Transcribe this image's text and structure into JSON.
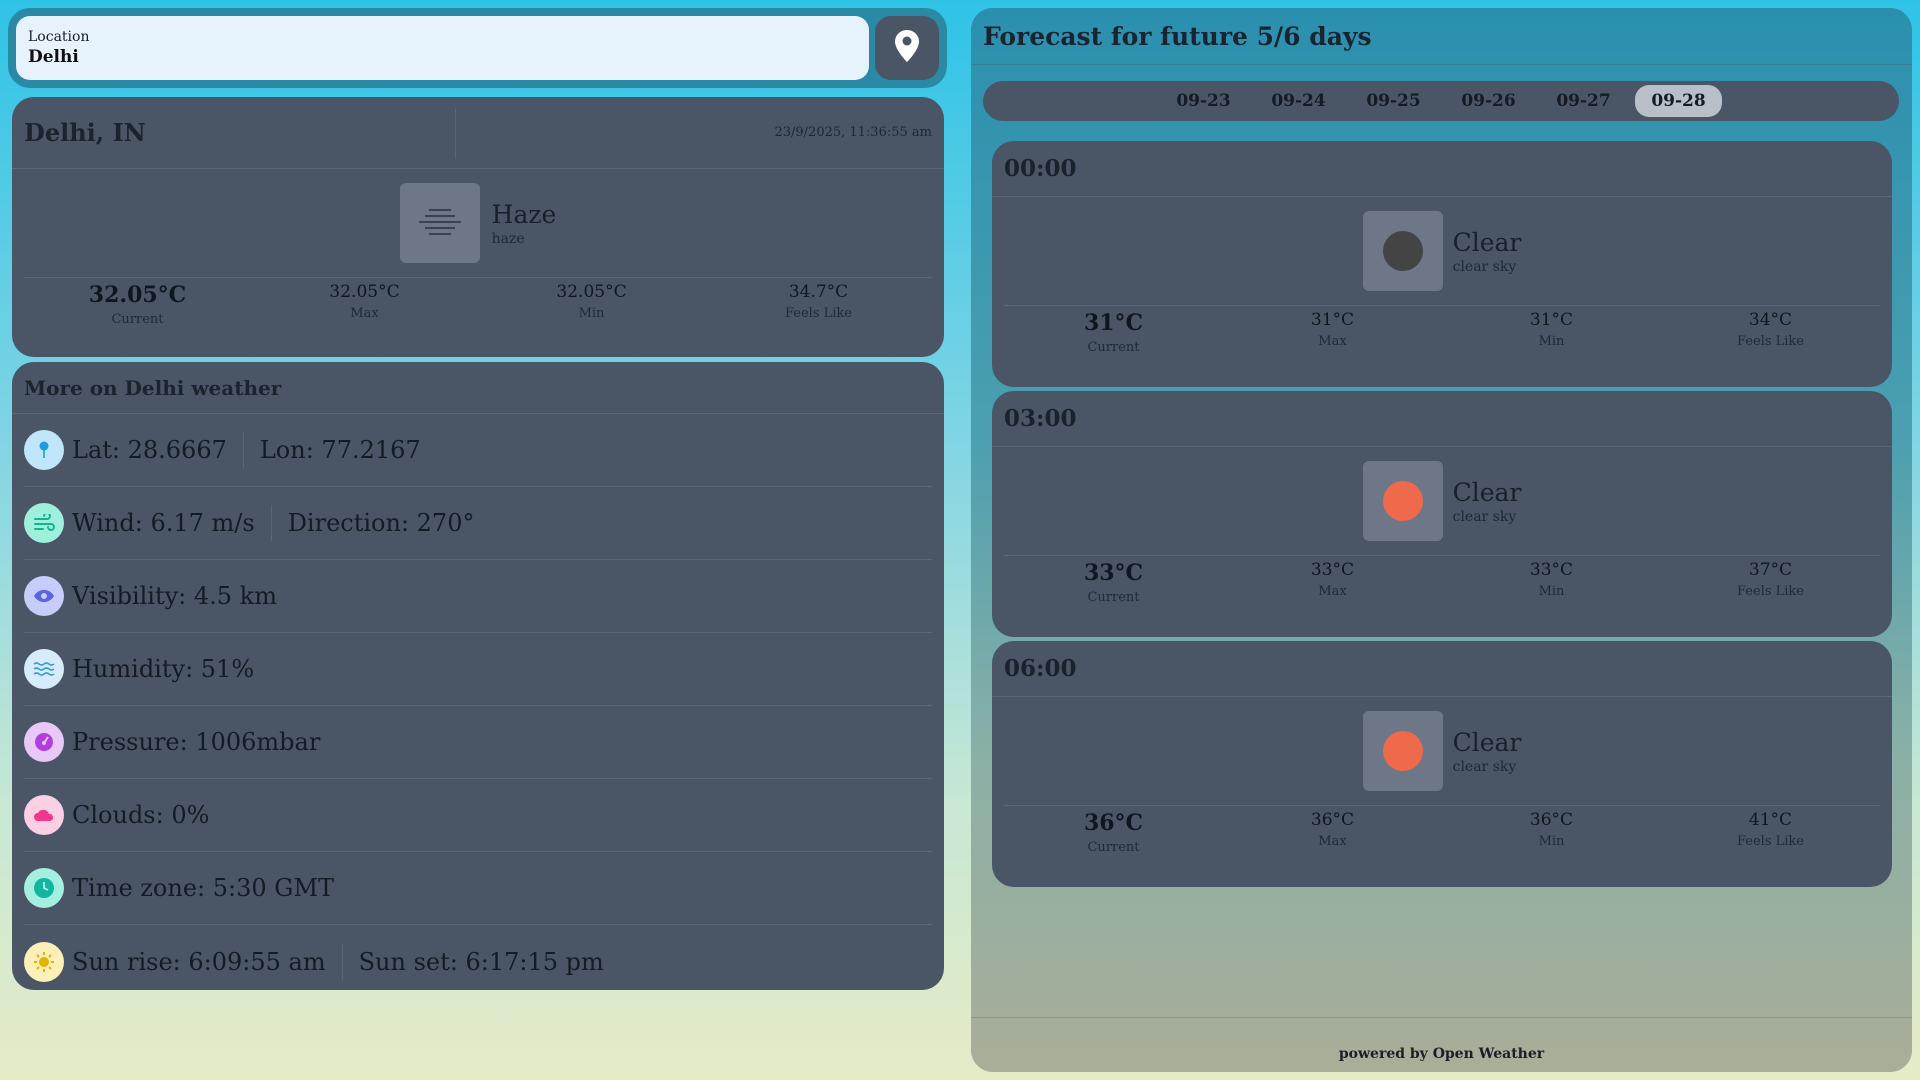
{
  "search": {
    "label": "Location",
    "value": "Delhi"
  },
  "current": {
    "city": "Delhi, IN",
    "datetime": "23/9/2025, 11:36:55 am",
    "condition": "Haze",
    "description": "haze",
    "stats": [
      {
        "value": "32.05°C",
        "label": "Current"
      },
      {
        "value": "32.05°C",
        "label": "Max"
      },
      {
        "value": "32.05°C",
        "label": "Min"
      },
      {
        "value": "34.7°C",
        "label": "Feels Like"
      }
    ]
  },
  "more": {
    "title": "More on Delhi weather",
    "lat": "Lat: 28.6667",
    "lon": "Lon: 77.2167",
    "wind": "Wind: 6.17 m/s",
    "direction": "Direction: 270°",
    "visibility": "Visibility: 4.5 km",
    "humidity": "Humidity: 51%",
    "pressure": "Pressure: 1006mbar",
    "clouds": "Clouds: 0%",
    "timezone": "Time zone: 5:30 GMT",
    "sunrise": "Sun rise: 6:09:55 am",
    "sunset": "Sun set: 6:17:15 pm"
  },
  "forecast": {
    "title": "Forecast for future 5/6 days",
    "dates": [
      "09-23",
      "09-24",
      "09-25",
      "09-26",
      "09-27",
      "09-28"
    ],
    "active_date": "09-28",
    "slots": [
      {
        "time": "00:00",
        "condition": "Clear",
        "description": "clear sky",
        "icon_color": "#444444",
        "stats": [
          {
            "value": "31°C",
            "label": "Current"
          },
          {
            "value": "31°C",
            "label": "Max"
          },
          {
            "value": "31°C",
            "label": "Min"
          },
          {
            "value": "34°C",
            "label": "Feels Like"
          }
        ]
      },
      {
        "time": "03:00",
        "condition": "Clear",
        "description": "clear sky",
        "icon_color": "#ee6a4a",
        "stats": [
          {
            "value": "33°C",
            "label": "Current"
          },
          {
            "value": "33°C",
            "label": "Max"
          },
          {
            "value": "33°C",
            "label": "Min"
          },
          {
            "value": "37°C",
            "label": "Feels Like"
          }
        ]
      },
      {
        "time": "06:00",
        "condition": "Clear",
        "description": "clear sky",
        "icon_color": "#ee6a4a",
        "stats": [
          {
            "value": "36°C",
            "label": "Current"
          },
          {
            "value": "36°C",
            "label": "Max"
          },
          {
            "value": "36°C",
            "label": "Min"
          },
          {
            "value": "41°C",
            "label": "Feels Like"
          }
        ]
      }
    ]
  },
  "footer": {
    "powered": "powered by Open Weather"
  },
  "colors": {
    "card": "#4a5566",
    "sun_icon": "#ee6a4a",
    "night_icon": "#444444"
  }
}
